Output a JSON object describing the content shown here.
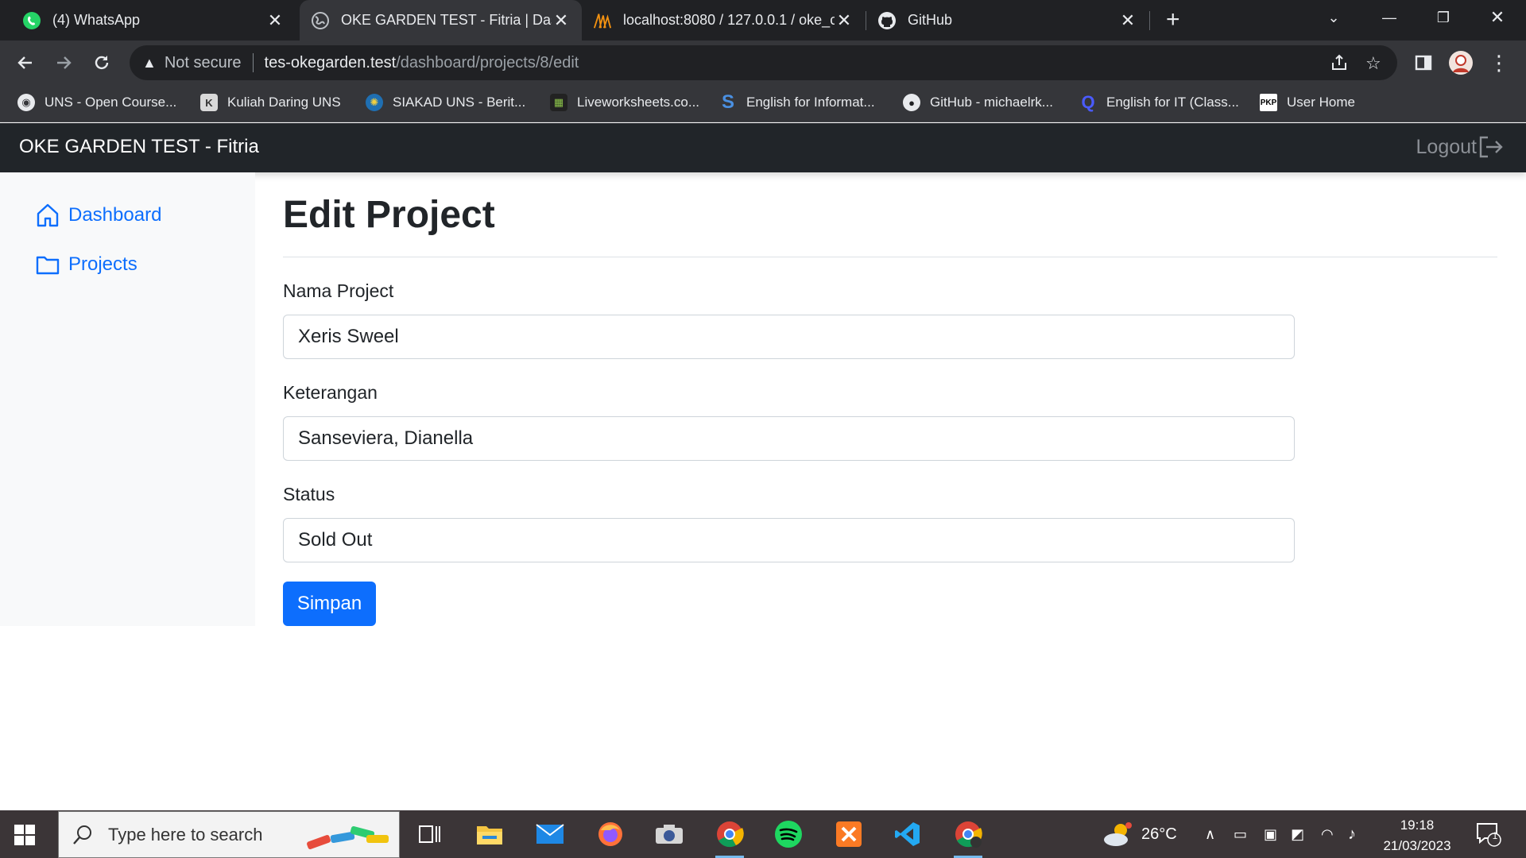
{
  "browser": {
    "tabs": [
      {
        "title": "(4) WhatsApp",
        "icon": "whatsapp-icon",
        "active": false
      },
      {
        "title": "OKE GARDEN TEST - Fitria | Dash",
        "icon": "globe-icon",
        "active": true
      },
      {
        "title": "localhost:8080 / 127.0.0.1 / oke_c",
        "icon": "phpmyadmin-icon",
        "active": false
      },
      {
        "title": "GitHub",
        "icon": "github-icon",
        "active": false
      }
    ],
    "address": {
      "security_label": "Not secure",
      "host": "tes-okegarden.test",
      "path": "/dashboard/projects/8/edit"
    },
    "bookmarks": [
      {
        "label": "UNS - Open Course...",
        "icon": "globe-icon"
      },
      {
        "label": "Kuliah Daring UNS",
        "icon": "kuliah-icon"
      },
      {
        "label": "SIAKAD UNS - Berit...",
        "icon": "siakad-icon"
      },
      {
        "label": "Liveworksheets.co...",
        "icon": "liveworksheets-icon"
      },
      {
        "label": "English for Informat...",
        "icon": "s-icon"
      },
      {
        "label": "GitHub - michaelrk...",
        "icon": "github-icon"
      },
      {
        "label": "English for IT (Class...",
        "icon": "q-icon"
      },
      {
        "label": "User Home",
        "icon": "pkp-icon"
      }
    ]
  },
  "app": {
    "brand": "OKE GARDEN TEST - Fitria",
    "logout_label": "Logout",
    "sidebar": [
      {
        "label": "Dashboard",
        "icon": "home-icon"
      },
      {
        "label": "Projects",
        "icon": "folder-icon"
      }
    ],
    "page_title": "Edit Project",
    "form": {
      "nama_label": "Nama Project",
      "nama_value": "Xeris Sweel",
      "keterangan_label": "Keterangan",
      "keterangan_value": "Sanseviera, Dianella",
      "status_label": "Status",
      "status_value": "Sold Out",
      "submit_label": "Simpan"
    }
  },
  "taskbar": {
    "search_placeholder": "Type here to search",
    "weather": "26°C",
    "time": "19:18",
    "date": "21/03/2023",
    "notification_count": "1"
  },
  "colors": {
    "primary": "#0d6efd",
    "navbar": "#212529",
    "sidebar": "#f8f9fa"
  }
}
